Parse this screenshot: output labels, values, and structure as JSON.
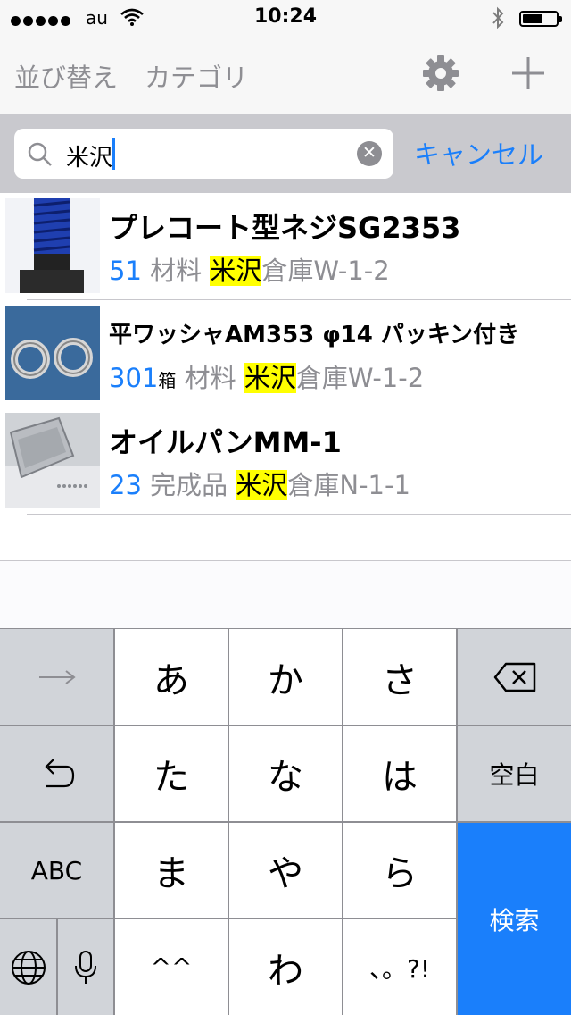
{
  "status_bar": {
    "carrier": "au",
    "time": "10:24"
  },
  "nav": {
    "sort_label": "並び替え",
    "category_label": "カテゴリ",
    "settings_icon": "gear-icon",
    "add_icon": "plus-icon"
  },
  "search": {
    "value": "米沢",
    "cancel_label": "キャンセル"
  },
  "results": [
    {
      "title": "プレコート型ネジSG2353",
      "quantity": "51",
      "unit": "",
      "category": "材料",
      "location_highlight": "米沢",
      "location_rest": "倉庫W-1-2"
    },
    {
      "title": "平ワッシャAM353 φ14 パッキン付き",
      "quantity": "301",
      "unit": "箱",
      "category": "材料",
      "location_highlight": "米沢",
      "location_rest": "倉庫W-1-2"
    },
    {
      "title": "オイルパンMM-1",
      "quantity": "23",
      "unit": "",
      "category": "完成品",
      "location_highlight": "米沢",
      "location_rest": "倉庫N-1-1"
    }
  ],
  "keyboard": {
    "row1": [
      "あ",
      "か",
      "さ"
    ],
    "row2": [
      "た",
      "な",
      "は"
    ],
    "row3": [
      "ま",
      "や",
      "ら"
    ],
    "row4": [
      "^^",
      "わ",
      "、。?!"
    ],
    "abc_label": "ABC",
    "space_label": "空白",
    "search_label": "検索"
  },
  "colors": {
    "accent": "#1a7ffb",
    "highlight": "#ffff00",
    "secondary_text": "#8e8e93"
  }
}
